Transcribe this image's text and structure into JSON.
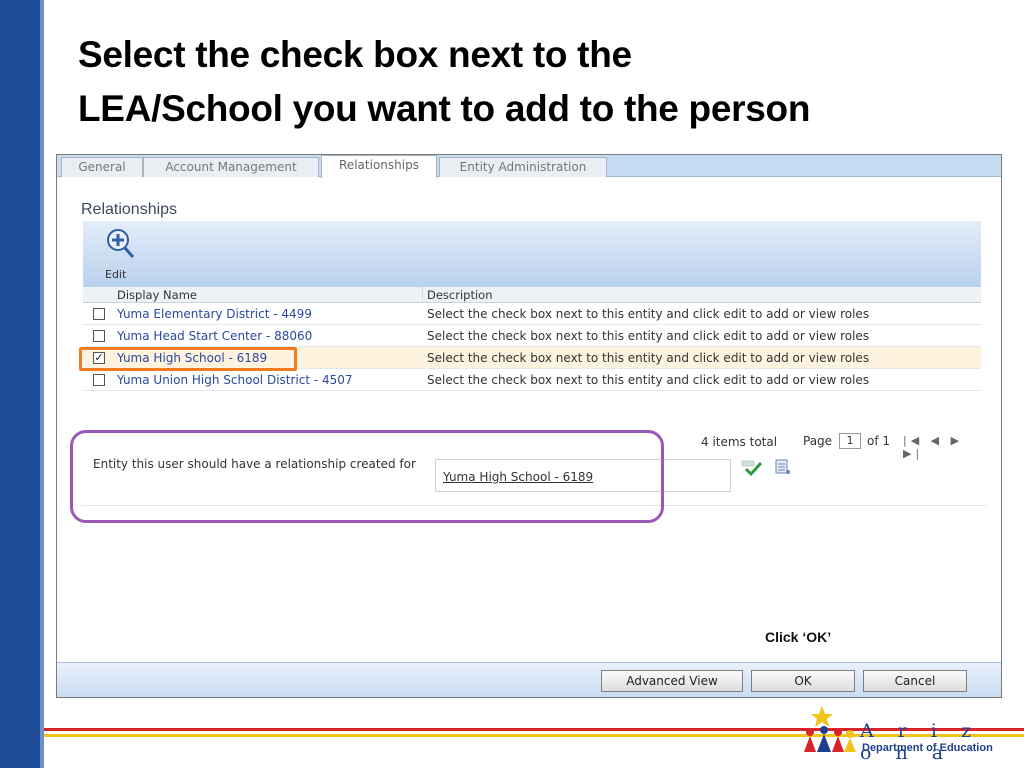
{
  "slide": {
    "title_line1": "Select the check box next to the",
    "title_line2": "LEA/School you want to add to the person"
  },
  "tabs": [
    {
      "label": "General"
    },
    {
      "label": "Account Management"
    },
    {
      "label": "Relationships",
      "active": true
    },
    {
      "label": "Entity Administration"
    }
  ],
  "relationships": {
    "heading": "Relationships",
    "edit_label": "Edit",
    "columns": {
      "display_name": "Display Name",
      "description": "Description"
    },
    "rows": [
      {
        "name": "Yuma Elementary District - 4499",
        "description": "Select the check box next to this entity and click edit to add or view roles",
        "checked": false
      },
      {
        "name": "Yuma Head Start Center - 88060",
        "description": "Select the check box next to this entity and click edit to add or view roles",
        "checked": false
      },
      {
        "name": "Yuma High School - 6189",
        "description": "Select the check box next to this entity and click edit to add or view roles",
        "checked": true
      },
      {
        "name": "Yuma Union High School District - 4507",
        "description": "Select the check box next to this entity and click edit to add or view roles",
        "checked": false
      }
    ],
    "checkmark": "✓"
  },
  "pager": {
    "total": "4 items total",
    "page_label": "Page",
    "page_value": "1",
    "of_label": "of 1",
    "nav_symbols": "|◀ ◀ ▶ ▶|"
  },
  "entity": {
    "label": "Entity this user should have a relationship created for",
    "value": "Yuma High School - 6189"
  },
  "annotation": {
    "click_ok": "Click ‘OK’"
  },
  "buttons": {
    "advanced_view": "Advanced View",
    "ok": "OK",
    "cancel": "Cancel"
  },
  "logo": {
    "state": "A r i z o n a",
    "department": "Department of Education"
  },
  "colors": {
    "orange_highlight": "#f47b20",
    "purple_highlight": "#9b59b6",
    "accent_blue": "#1f4c97"
  }
}
